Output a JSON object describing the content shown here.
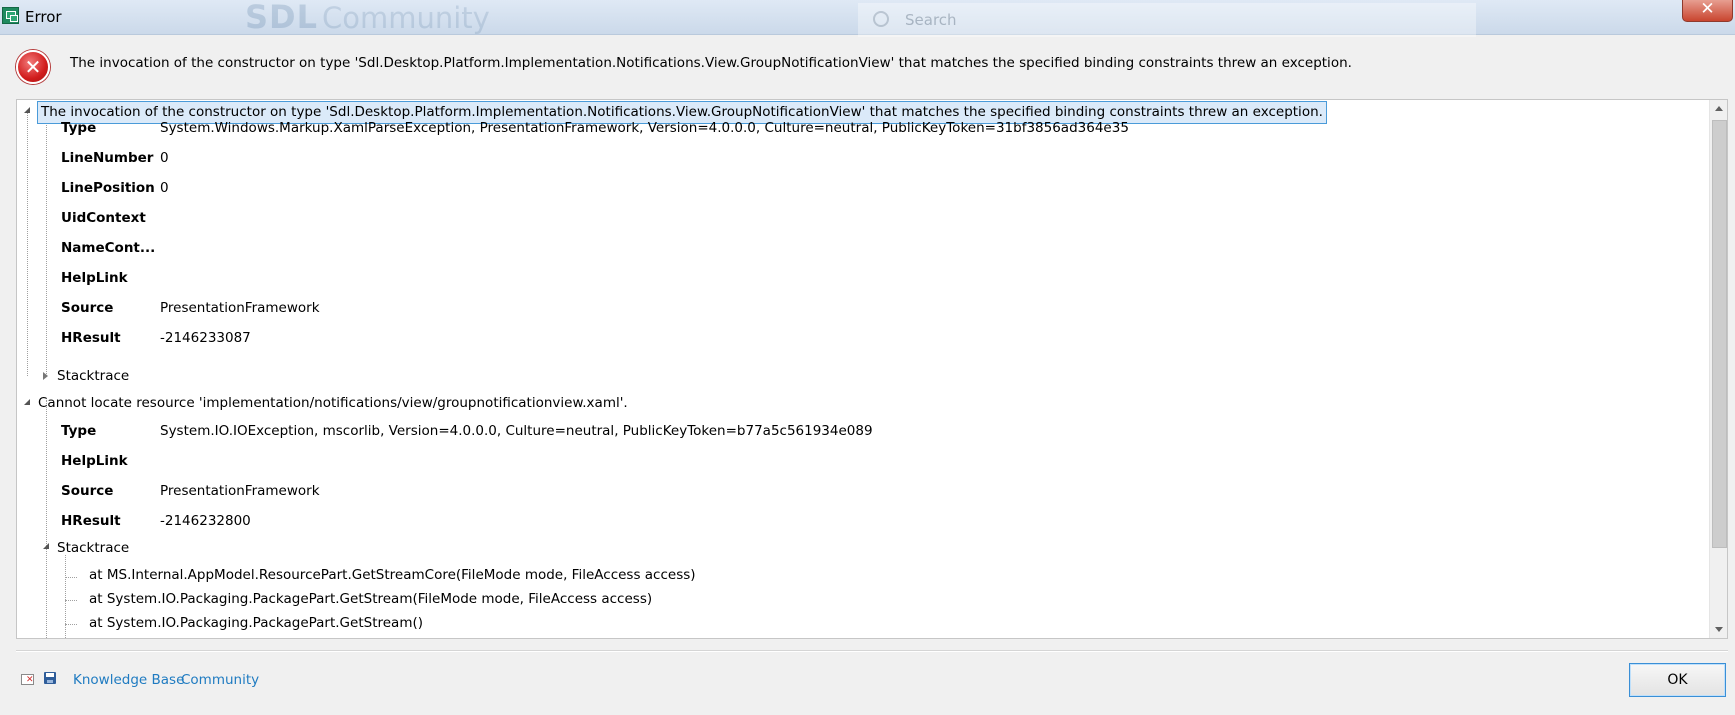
{
  "window": {
    "title": "Error",
    "close_glyph": "✕",
    "background_logo": "SDL",
    "background_logo_sub": "Community",
    "background_search_placeholder": "Search"
  },
  "header": {
    "icon": "error-icon",
    "icon_glyph": "✕",
    "message": "The invocation of the constructor on type 'Sdl.Desktop.Platform.Implementation.Notifications.View.GroupNotificationView' that matches the specified binding constraints threw an exception."
  },
  "tree": {
    "exception1": {
      "message": "The invocation of the constructor on type 'Sdl.Desktop.Platform.Implementation.Notifications.View.GroupNotificationView' that matches the specified binding constraints threw an exception.",
      "props": [
        {
          "name": "Type",
          "value": "System.Windows.Markup.XamlParseException, PresentationFramework, Version=4.0.0.0, Culture=neutral, PublicKeyToken=31bf3856ad364e35"
        },
        {
          "name": "LineNumber",
          "value": "0"
        },
        {
          "name": "LinePosition",
          "value": "0"
        },
        {
          "name": "UidContext",
          "value": ""
        },
        {
          "name": "NameCont...",
          "value": ""
        },
        {
          "name": "HelpLink",
          "value": ""
        },
        {
          "name": "Source",
          "value": "PresentationFramework"
        },
        {
          "name": "HResult",
          "value": "-2146233087"
        }
      ],
      "stacktrace_label": "Stacktrace"
    },
    "exception2": {
      "message": "Cannot locate resource 'implementation/notifications/view/groupnotificationview.xaml'.",
      "props": [
        {
          "name": "Type",
          "value": "System.IO.IOException, mscorlib, Version=4.0.0.0, Culture=neutral, PublicKeyToken=b77a5c561934e089"
        },
        {
          "name": "HelpLink",
          "value": ""
        },
        {
          "name": "Source",
          "value": "PresentationFramework"
        },
        {
          "name": "HResult",
          "value": "-2146232800"
        }
      ],
      "stacktrace_label": "Stacktrace",
      "stacktrace": [
        "at MS.Internal.AppModel.ResourcePart.GetStreamCore(FileMode mode, FileAccess access)",
        "at System.IO.Packaging.PackagePart.GetStream(FileMode mode, FileAccess access)",
        "at System.IO.Packaging.PackagePart.GetStream()"
      ]
    }
  },
  "footer": {
    "icons": [
      "clear-icon",
      "save-icon"
    ],
    "links": [
      "Knowledge Base",
      "Community"
    ],
    "ok_label": "OK"
  },
  "colors": {
    "link": "#1f7bc1",
    "selection_border": "#4a9bd9",
    "selection_fill": "#dbeaf9",
    "error_red": "#d11d1d"
  }
}
